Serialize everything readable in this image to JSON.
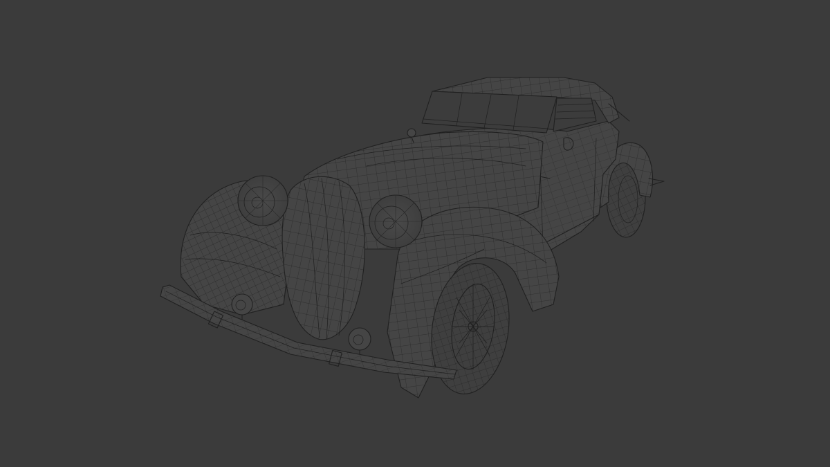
{
  "viewport": {
    "background_color": "#3b3b3b",
    "shading": "wireframe-on-solid",
    "subject": "vintage-roadster-model"
  },
  "colors": {
    "mesh_fill": "#454545",
    "wire": "#202020"
  }
}
